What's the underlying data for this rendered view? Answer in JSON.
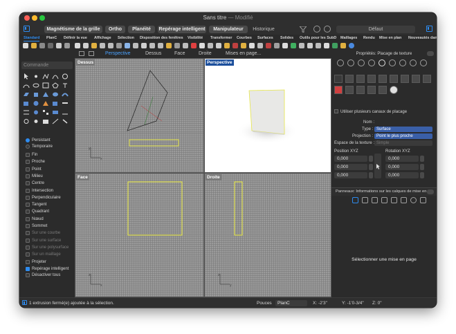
{
  "window": {
    "title": "Sans titre",
    "modified": "— Modifié"
  },
  "modebar": {
    "buttons": [
      "Magnétisme de la grille",
      "Ortho",
      "Planéité",
      "Repérage intelligent",
      "Manipulateur",
      "Historique"
    ],
    "default_label": "Défaut"
  },
  "tabs": [
    "Standard",
    "PlanC",
    "Définir la vue",
    "Affichage",
    "Sélection",
    "Disposition des fenêtres",
    "Visibilité",
    "Transformer",
    "Courbes",
    "Surfaces",
    "Solides",
    "Outils pour les SubD",
    "Maillages",
    "Rendu",
    "Mise en plan",
    "Nouveautés dans"
  ],
  "viewtabs": [
    "Perspective",
    "Dessus",
    "Face",
    "Droite",
    "Mises en page..."
  ],
  "command": {
    "placeholder": "Commande"
  },
  "osnap": {
    "persistent": "Persistant",
    "temporary": "Temporaire",
    "items": [
      {
        "label": "Fin",
        "checked": false,
        "dim": false
      },
      {
        "label": "Proche",
        "checked": false,
        "dim": false
      },
      {
        "label": "Point",
        "checked": false,
        "dim": false
      },
      {
        "label": "Milieu",
        "checked": false,
        "dim": false
      },
      {
        "label": "Centre",
        "checked": false,
        "dim": false
      },
      {
        "label": "Intersection",
        "checked": false,
        "dim": false
      },
      {
        "label": "Perpendiculaire",
        "checked": false,
        "dim": false
      },
      {
        "label": "Tangent",
        "checked": false,
        "dim": false
      },
      {
        "label": "Quadrant",
        "checked": false,
        "dim": false
      },
      {
        "label": "Nœud",
        "checked": false,
        "dim": false
      },
      {
        "label": "Sommet",
        "checked": false,
        "dim": false
      },
      {
        "label": "Sur une courbe",
        "checked": false,
        "dim": true
      },
      {
        "label": "Sur une surface",
        "checked": false,
        "dim": true
      },
      {
        "label": "Sur une polysurface",
        "checked": false,
        "dim": true
      },
      {
        "label": "Sur un maillage",
        "checked": false,
        "dim": true
      },
      {
        "label": "Projeter",
        "checked": false,
        "dim": false
      },
      {
        "label": "Repérage intelligent",
        "checked": true,
        "dim": false
      }
    ],
    "disable_all": "Désactiver tous"
  },
  "viewports": {
    "top": "Dessus",
    "perspective": "Perspective",
    "front": "Face",
    "right": "Droite"
  },
  "properties": {
    "title": "Propriétés: Placage de texture",
    "multi_channel": "Utiliser plusieurs canaux de placage",
    "name_label": "Nom :",
    "type_label": "Type :",
    "type_value": "Surface",
    "projection_label": "Projection :",
    "projection_value": "Point le plus proche",
    "texture_space_label": "Espace de la texture :",
    "texture_space_value": "Simple",
    "position_label": "Position XYZ",
    "rotation_label": "Rotation XYZ",
    "position": [
      "0,000",
      "0,000",
      "0,000"
    ],
    "rotation": [
      "0,000",
      "0,000",
      "0,000"
    ]
  },
  "panels": {
    "title": "Panneaux: Informations sur les calques de mise en ...",
    "empty": "Sélectionner une mise en page"
  },
  "status": {
    "message": "1 extrusion fermé(e) ajoutée à la sélection.",
    "units": "Pouces",
    "plane": "PlanC",
    "x": "X: -2'3\"",
    "y": "Y: -1'0-3/4\"",
    "z": "Z: 0\""
  },
  "colors": {
    "accent": "#2e8cf0",
    "selection": "#e6e64a",
    "background": "#2b2b2b"
  }
}
